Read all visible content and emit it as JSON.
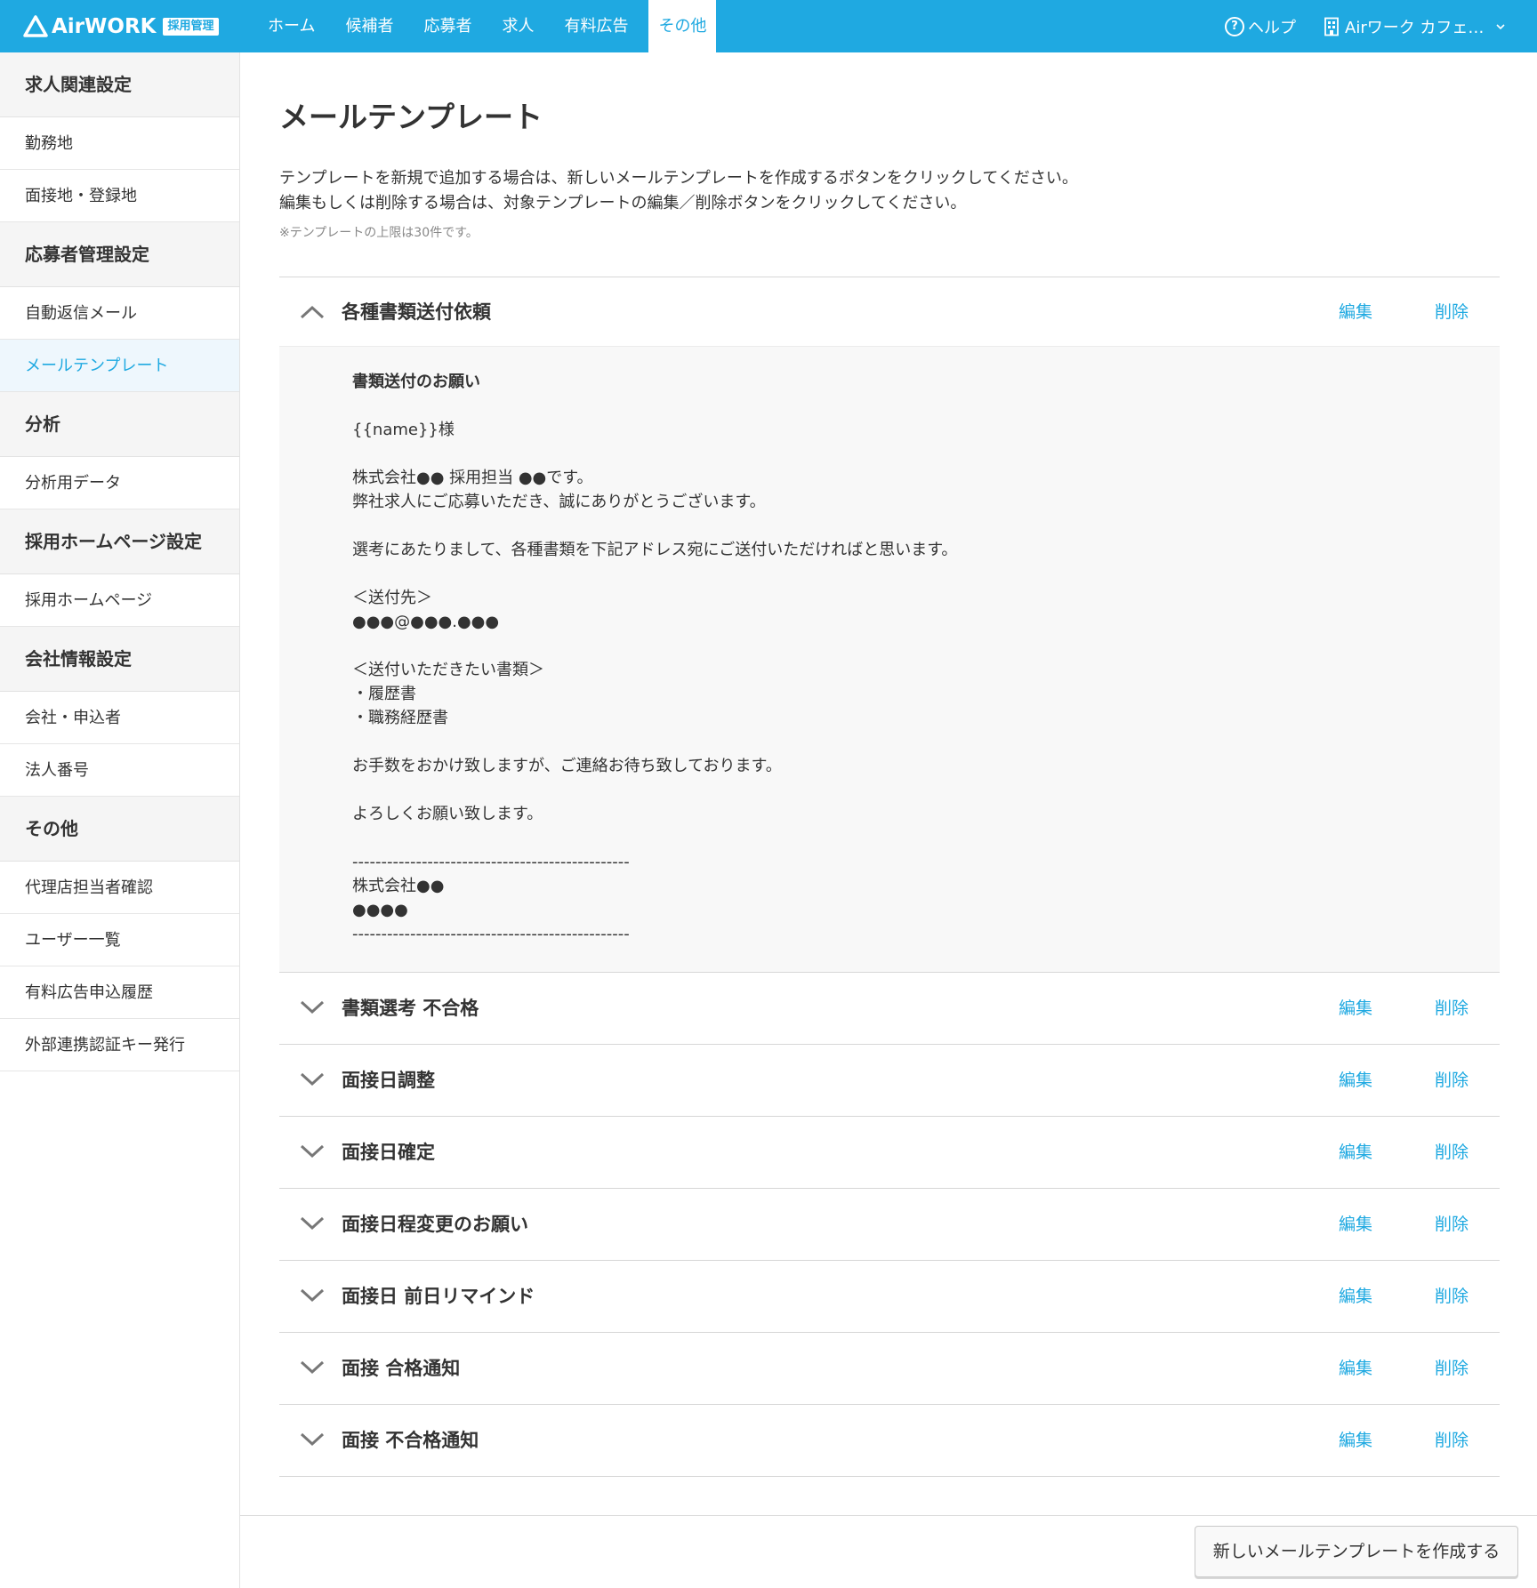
{
  "header": {
    "logo_text": "AirWORK",
    "logo_badge": "採用管理",
    "nav": [
      "ホーム",
      "候補者",
      "応募者",
      "求人",
      "有料広告",
      "その他"
    ],
    "help_label": "ヘルプ",
    "help_icon_glyph": "?",
    "account_label": "Airワーク カフェ…",
    "brand_color": "#1fa9e1"
  },
  "sidebar": {
    "sections": [
      {
        "heading": "求人関連設定",
        "items": [
          "勤務地",
          "面接地・登録地"
        ]
      },
      {
        "heading": "応募者管理設定",
        "items": [
          "自動返信メール",
          "メールテンプレート"
        ]
      },
      {
        "heading": "分析",
        "items": [
          "分析用データ"
        ]
      },
      {
        "heading": "採用ホームページ設定",
        "items": [
          "採用ホームページ"
        ]
      },
      {
        "heading": "会社情報設定",
        "items": [
          "会社・申込者",
          "法人番号"
        ]
      },
      {
        "heading": "その他",
        "items": [
          "代理店担当者確認",
          "ユーザー一覧",
          "有料広告申込履歴",
          "外部連携認証キー発行"
        ]
      }
    ],
    "active_item": "メールテンプレート"
  },
  "main": {
    "title": "メールテンプレート",
    "desc_line1": "テンプレートを新規で追加する場合は、新しいメールテンプレートを作成するボタンをクリックしてください。",
    "desc_line2": "編集もしくは削除する場合は、対象テンプレートの編集／削除ボタンをクリックしてください。",
    "note": "※テンプレートの上限は30件です。",
    "edit_label": "編集",
    "delete_label": "削除",
    "templates": [
      "各種書類送付依頼",
      "書類選考 不合格",
      "面接日調整",
      "面接日確定",
      "面接日程変更のお願い",
      "面接日 前日リマインド",
      "面接 合格通知",
      "面接 不合格通知"
    ],
    "open_template": {
      "subject": "書類送付のお願い",
      "body": "\n\n{{name}}様\n\n株式会社●● 採用担当 ●●です。\n弊社求人にご応募いただき、誠にありがとうございます。\n\n選考にあたりまして、各種書類を下記アドレス宛にご送付いただければと思います。\n\n＜送付先＞\n●●●@●●●.●●●\n\n＜送付いただきたい書類＞\n・履歴書\n・職務経歴書\n\nお手数をおかけ致しますが、ご連絡お待ち致しております。\n\nよろしくお願い致します。\n\n------------------------------------------------\n株式会社●●\n●●●●\n------------------------------------------------"
    },
    "create_button": "新しいメールテンプレートを作成する"
  }
}
